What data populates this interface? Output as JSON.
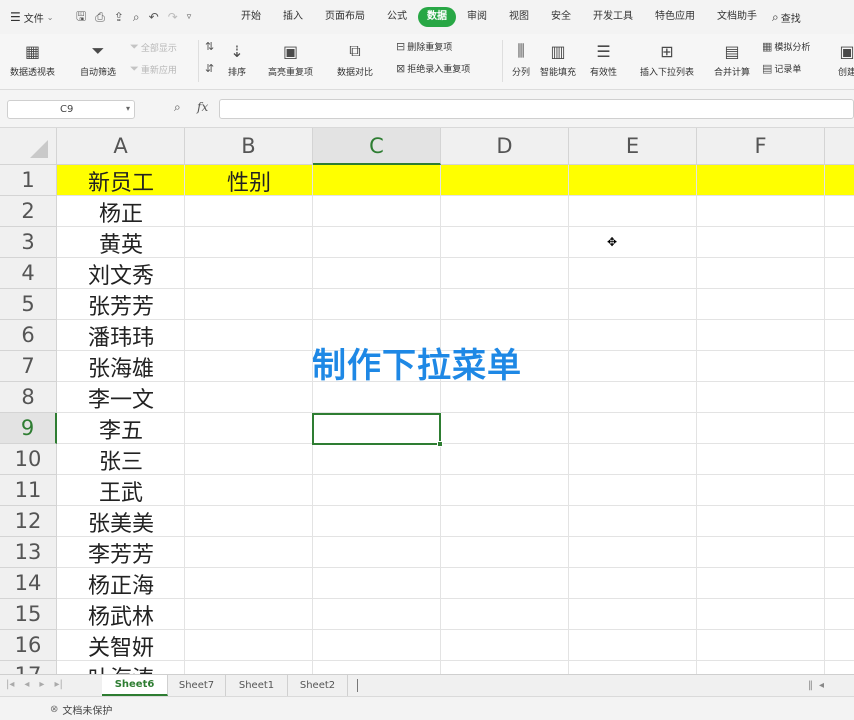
{
  "menubar": {
    "file_label": "文件",
    "tabs": [
      "开始",
      "插入",
      "页面布局",
      "公式",
      "数据",
      "审阅",
      "视图",
      "安全",
      "开发工具",
      "特色应用",
      "文档助手"
    ],
    "active_tab": "数据",
    "search_label": "查找"
  },
  "ribbon": {
    "pivot": "数据透视表",
    "autofilter": "自动筛选",
    "show_all": "全部显示",
    "reapply": "重新应用",
    "sort": "排序",
    "highlight_dup": "高亮重复项",
    "compare": "数据对比",
    "delete_dup": "删除重复项",
    "reject_dup": "拒绝录入重复项",
    "split": "分列",
    "fill": "智能填充",
    "validation": "有效性",
    "dropdown": "插入下拉列表",
    "consolidate": "合并计算",
    "whatif": "模拟分析",
    "record": "记录单",
    "create": "创建"
  },
  "formula_bar": {
    "name_box": "C9",
    "fx_label": "fx",
    "value": ""
  },
  "grid": {
    "columns": [
      "A",
      "B",
      "C",
      "D",
      "E",
      "F"
    ],
    "selected_column": "C",
    "rows": [
      "1",
      "2",
      "3",
      "4",
      "5",
      "6",
      "7",
      "8",
      "9",
      "10",
      "11",
      "12",
      "13",
      "14",
      "15",
      "16",
      "17"
    ],
    "selected_row": "9",
    "header_a": "新员工",
    "header_b": "性别",
    "names": [
      "杨正",
      "黄英",
      "刘文秀",
      "张芳芳",
      "潘玮玮",
      "张海雄",
      "李一文",
      "李五",
      "张三",
      "王武",
      "张美美",
      "李芳芳",
      "杨正海",
      "杨武林",
      "关智妍",
      "叶海涛"
    ],
    "highlight_color": "#ffff00",
    "selection_color": "#2e7d32"
  },
  "overlay": {
    "title": "制作下拉菜单",
    "color": "#1e88e5"
  },
  "sheets": {
    "tabs": [
      "Sheet6",
      "Sheet7",
      "Sheet1",
      "Sheet2"
    ],
    "active": "Sheet6"
  },
  "statusbar": {
    "protection": "文档未保护"
  }
}
